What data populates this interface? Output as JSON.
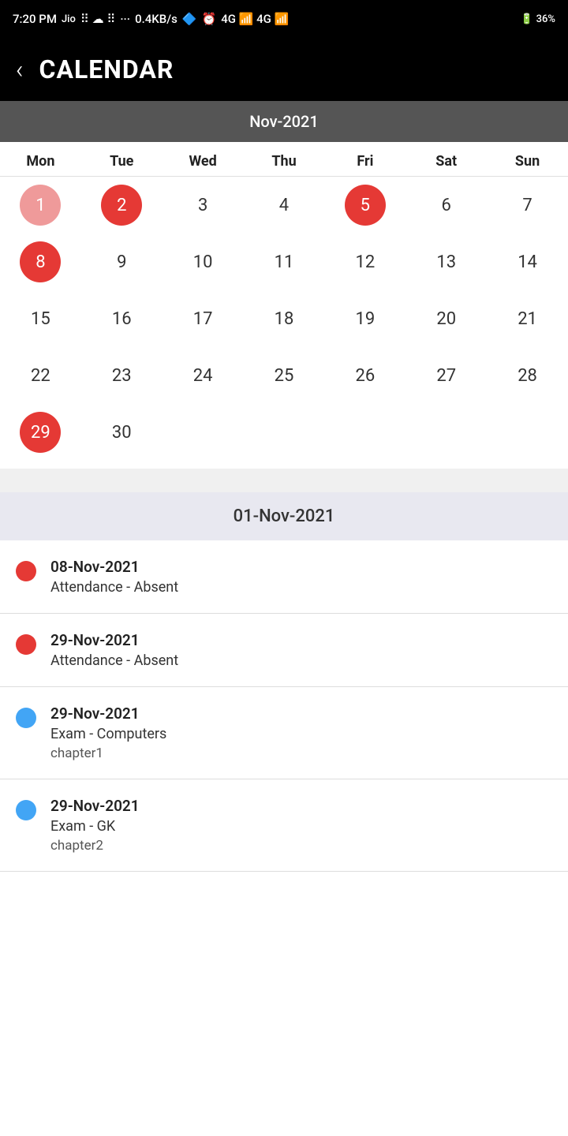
{
  "statusBar": {
    "time": "7:20 PM",
    "network": "0.4KB/s",
    "battery": "36%"
  },
  "header": {
    "title": "CALENDAR",
    "backLabel": "‹"
  },
  "calendar": {
    "monthLabel": "Nov-2021",
    "weekdays": [
      "Mon",
      "Tue",
      "Wed",
      "Thu",
      "Fri",
      "Sat",
      "Sun"
    ],
    "weeks": [
      [
        {
          "day": "1",
          "style": "red-light"
        },
        {
          "day": "2",
          "style": "red-full"
        },
        {
          "day": "3",
          "style": "normal"
        },
        {
          "day": "4",
          "style": "normal"
        },
        {
          "day": "5",
          "style": "red-full"
        },
        {
          "day": "6",
          "style": "normal"
        },
        {
          "day": "7",
          "style": "normal"
        }
      ],
      [
        {
          "day": "8",
          "style": "red-full"
        },
        {
          "day": "9",
          "style": "normal"
        },
        {
          "day": "10",
          "style": "normal"
        },
        {
          "day": "11",
          "style": "normal"
        },
        {
          "day": "12",
          "style": "normal"
        },
        {
          "day": "13",
          "style": "normal"
        },
        {
          "day": "14",
          "style": "normal"
        }
      ],
      [
        {
          "day": "15",
          "style": "normal"
        },
        {
          "day": "16",
          "style": "normal"
        },
        {
          "day": "17",
          "style": "normal"
        },
        {
          "day": "18",
          "style": "normal"
        },
        {
          "day": "19",
          "style": "normal"
        },
        {
          "day": "20",
          "style": "normal"
        },
        {
          "day": "21",
          "style": "normal"
        }
      ],
      [
        {
          "day": "22",
          "style": "normal"
        },
        {
          "day": "23",
          "style": "normal"
        },
        {
          "day": "24",
          "style": "normal"
        },
        {
          "day": "25",
          "style": "normal"
        },
        {
          "day": "26",
          "style": "normal"
        },
        {
          "day": "27",
          "style": "normal"
        },
        {
          "day": "28",
          "style": "normal"
        }
      ],
      [
        {
          "day": "29",
          "style": "red-full"
        },
        {
          "day": "30",
          "style": "normal"
        },
        {
          "day": "",
          "style": "normal"
        },
        {
          "day": "",
          "style": "normal"
        },
        {
          "day": "",
          "style": "normal"
        },
        {
          "day": "",
          "style": "normal"
        },
        {
          "day": "",
          "style": "normal"
        }
      ]
    ]
  },
  "eventsSection": {
    "headerDate": "01-Nov-2021",
    "events": [
      {
        "dotColor": "red",
        "date": "08-Nov-2021",
        "title": "Attendance - Absent",
        "subtitle": ""
      },
      {
        "dotColor": "red",
        "date": "29-Nov-2021",
        "title": "Attendance - Absent",
        "subtitle": ""
      },
      {
        "dotColor": "blue",
        "date": "29-Nov-2021",
        "title": "Exam - Computers",
        "subtitle": "chapter1"
      },
      {
        "dotColor": "blue",
        "date": "29-Nov-2021",
        "title": "Exam - GK",
        "subtitle": "chapter2"
      }
    ]
  }
}
